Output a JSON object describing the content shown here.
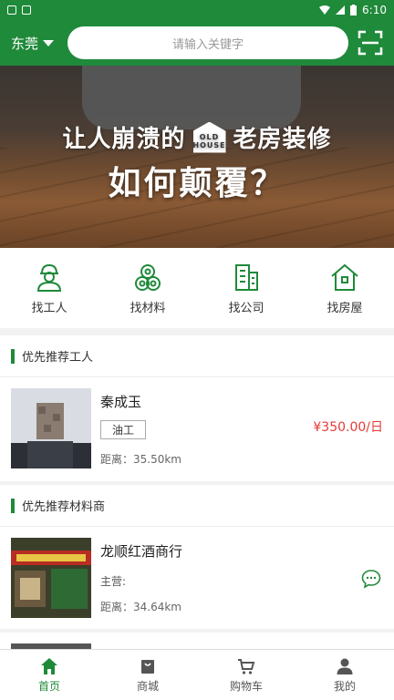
{
  "status_bar": {
    "time": "6:10"
  },
  "header": {
    "city": "东莞",
    "search_placeholder": "请输入关键字"
  },
  "banner": {
    "line1_left": "让人崩溃的",
    "logo_top": "OLD",
    "logo_bottom": "HOUSE",
    "line1_right": "老房装修",
    "line2": "如何颠覆？"
  },
  "categories": [
    {
      "label": "找工人",
      "icon": "worker-icon"
    },
    {
      "label": "找材料",
      "icon": "material-icon"
    },
    {
      "label": "找公司",
      "icon": "company-icon"
    },
    {
      "label": "找房屋",
      "icon": "house-icon"
    }
  ],
  "workers_section": {
    "title": "优先推荐工人",
    "item": {
      "name": "秦成玉",
      "tag": "油工",
      "price": "¥350.00/日",
      "distance": "距离：35.50km"
    }
  },
  "materials_section": {
    "title": "优先推荐材料商",
    "item": {
      "name": "龙顺红酒商行",
      "main_label": "主营:",
      "distance": "距离：34.64km"
    }
  },
  "bottom_nav": [
    {
      "label": "首页",
      "icon": "home-icon",
      "active": true
    },
    {
      "label": "商城",
      "icon": "shop-icon",
      "active": false
    },
    {
      "label": "购物车",
      "icon": "cart-icon",
      "active": false
    },
    {
      "label": "我的",
      "icon": "user-icon",
      "active": false
    }
  ],
  "colors": {
    "brand_green": "#1f8a3a",
    "price_red": "#e53935"
  }
}
